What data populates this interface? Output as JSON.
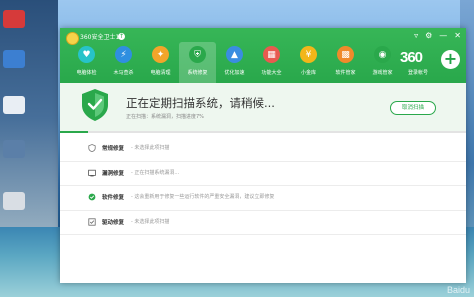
{
  "window": {
    "title": "360安全卫士11",
    "controls": [
      "▿",
      "⚙",
      "—",
      "✕"
    ]
  },
  "nav": {
    "items": [
      {
        "label": "电脑体检",
        "icon": "health-check-icon",
        "color": "#27c3c9",
        "glyph": "♥"
      },
      {
        "label": "木马查杀",
        "icon": "trojan-kill-icon",
        "color": "#2f8fe0",
        "glyph": "⚡"
      },
      {
        "label": "电脑清理",
        "icon": "cleanup-icon",
        "color": "#f3a52a",
        "glyph": "✦"
      },
      {
        "label": "系统修复",
        "icon": "system-repair-icon",
        "color": "#2aa84b",
        "glyph": "⛨",
        "active": true
      },
      {
        "label": "优化加速",
        "icon": "speedup-icon",
        "color": "#3a8de0",
        "glyph": "▲"
      },
      {
        "label": "功能大全",
        "icon": "feature-list-icon",
        "color": "#e85a4f",
        "glyph": "▦"
      },
      {
        "label": "小金库",
        "icon": "treasury-icon",
        "color": "#f2b619",
        "glyph": "¥"
      },
      {
        "label": "软件管家",
        "icon": "software-manager-icon",
        "color": "#f08a2b",
        "glyph": "▩"
      },
      {
        "label": "游戏管家",
        "icon": "game-manager-icon",
        "color": "#2aa84b",
        "glyph": "◉"
      }
    ]
  },
  "brand": {
    "logo_text": "360",
    "login_label": "登录帐号"
  },
  "scan": {
    "title": "正在定期扫描系统，请稍候...",
    "status": "正在扫描：系统漏洞，扫描进度7%",
    "progress": 0.07,
    "cancel_label": "取消扫描"
  },
  "checks": [
    {
      "name": "常规修复",
      "desc": "- 未选择此项扫描",
      "icon": "routine-repair-icon"
    },
    {
      "name": "漏洞修复",
      "desc": "- 正在扫描系统漏洞...",
      "icon": "vulnerability-repair-icon"
    },
    {
      "name": "软件修复",
      "desc": "- 这会重新用于修复一些运行软件的严重安全漏洞，建议立即修复",
      "icon": "software-repair-icon"
    },
    {
      "name": "驱动修复",
      "desc": "- 未选择此项扫描",
      "icon": "driver-repair-icon"
    }
  ],
  "colors": {
    "accent": "#2aa84b",
    "titlebar": "#25a448"
  },
  "watermark": "Baidu"
}
